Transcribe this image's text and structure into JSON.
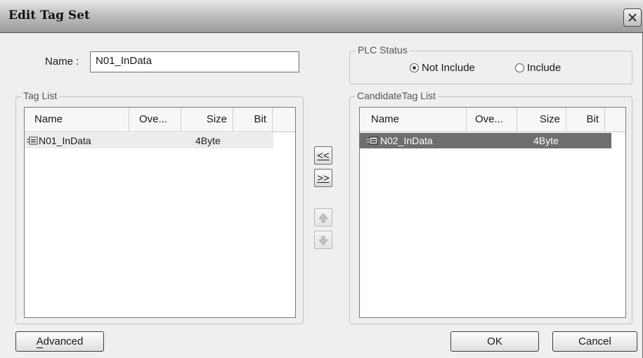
{
  "window": {
    "title": "Edit Tag Set"
  },
  "name_field": {
    "label": "Name :",
    "value": "N01_InData"
  },
  "plc_status": {
    "legend": "PLC Status",
    "options": [
      {
        "label": "Not Include",
        "selected": true
      },
      {
        "label": "Include",
        "selected": false
      }
    ]
  },
  "tag_list": {
    "legend": "Tag List",
    "columns": [
      "Name",
      "Ove...",
      "Size",
      "Bit"
    ],
    "rows": [
      {
        "name": "N01_InData",
        "ove": "",
        "size": "4Byte",
        "bit": ""
      }
    ]
  },
  "candidate_list": {
    "legend": "CandidateTag List",
    "columns": [
      "Name",
      "Ove...",
      "Size",
      "Bit"
    ],
    "rows": [
      {
        "name": "N02_InData",
        "ove": "",
        "size": "4Byte",
        "bit": "",
        "selected": true
      }
    ]
  },
  "transfer": {
    "add_label": "<<",
    "remove_label": ">>"
  },
  "buttons": {
    "advanced": "Advanced",
    "ok": "OK",
    "cancel": "Cancel"
  },
  "colors": {
    "selection": "#6e6e6e",
    "selection_text": "#ffffff",
    "icon": "tag-icon"
  }
}
